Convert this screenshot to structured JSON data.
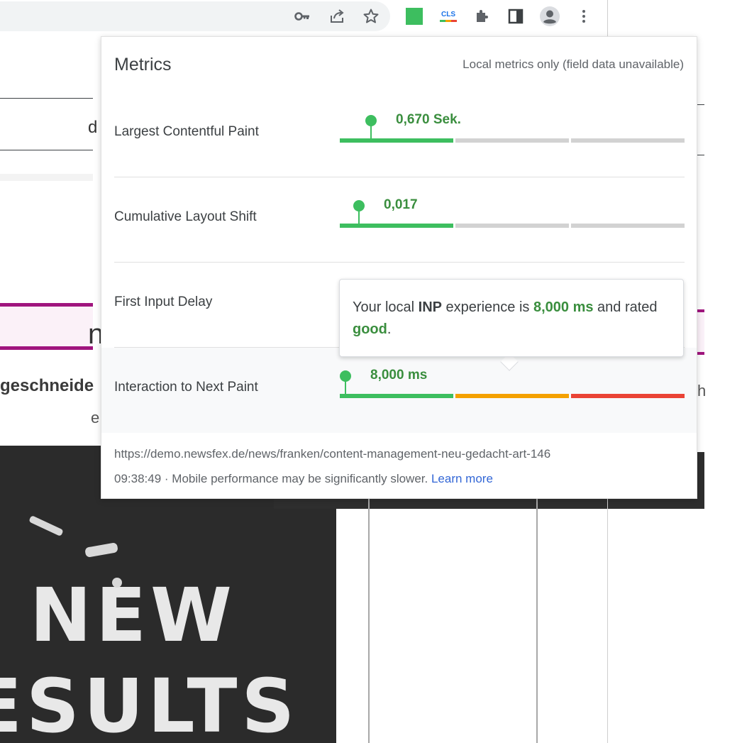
{
  "colors": {
    "good": "#3dbe5f",
    "good_text": "#3a8e3e",
    "needs_improvement": "#f4a100",
    "poor": "#ea4335",
    "inactive": "#d2d2d2",
    "brand_purple": "#a0157e"
  },
  "toolbar": {
    "icons": [
      "key-icon",
      "share-icon",
      "star-icon",
      "green-square-extension-icon",
      "cls-extension-icon",
      "puzzle-icon",
      "side-panel-icon",
      "profile-icon",
      "more-vert-icon"
    ],
    "cls_badge": "CLS"
  },
  "background": {
    "text_d": "d",
    "text_n": "n",
    "text_word": "geschneide",
    "text_e": "e",
    "text_h": "h",
    "chalk_line1": "NEW",
    "chalk_line2": "ESULTS"
  },
  "popup": {
    "title": "Metrics",
    "subtitle": "Local metrics only (field data unavailable)",
    "metrics": [
      {
        "label": "Largest Contentful Paint",
        "value": "0,670 Sek.",
        "marker_fraction": 0.09,
        "rating": "good",
        "active_segment": 0
      },
      {
        "label": "Cumulative Layout Shift",
        "value": "0,017",
        "marker_fraction": 0.055,
        "rating": "good",
        "active_segment": 0
      },
      {
        "label": "First Input Delay"
      },
      {
        "label": "Interaction to Next Paint",
        "value": "8,000 ms",
        "marker_fraction": 0.016,
        "rating": "good",
        "active_segment": "all"
      }
    ],
    "tooltip": {
      "t1": "Your local ",
      "metric": "INP",
      "t2": " experience is ",
      "value": "8,000 ms",
      "t3": " and rated ",
      "rating": "good",
      "t4": "."
    },
    "footer": {
      "url": "https://demo.newsfex.de/news/franken/content-management-neu-gedacht-art-146",
      "time": "09:38:49",
      "separator": " · ",
      "note": "Mobile performance may be significantly slower. ",
      "link": "Learn more"
    }
  }
}
